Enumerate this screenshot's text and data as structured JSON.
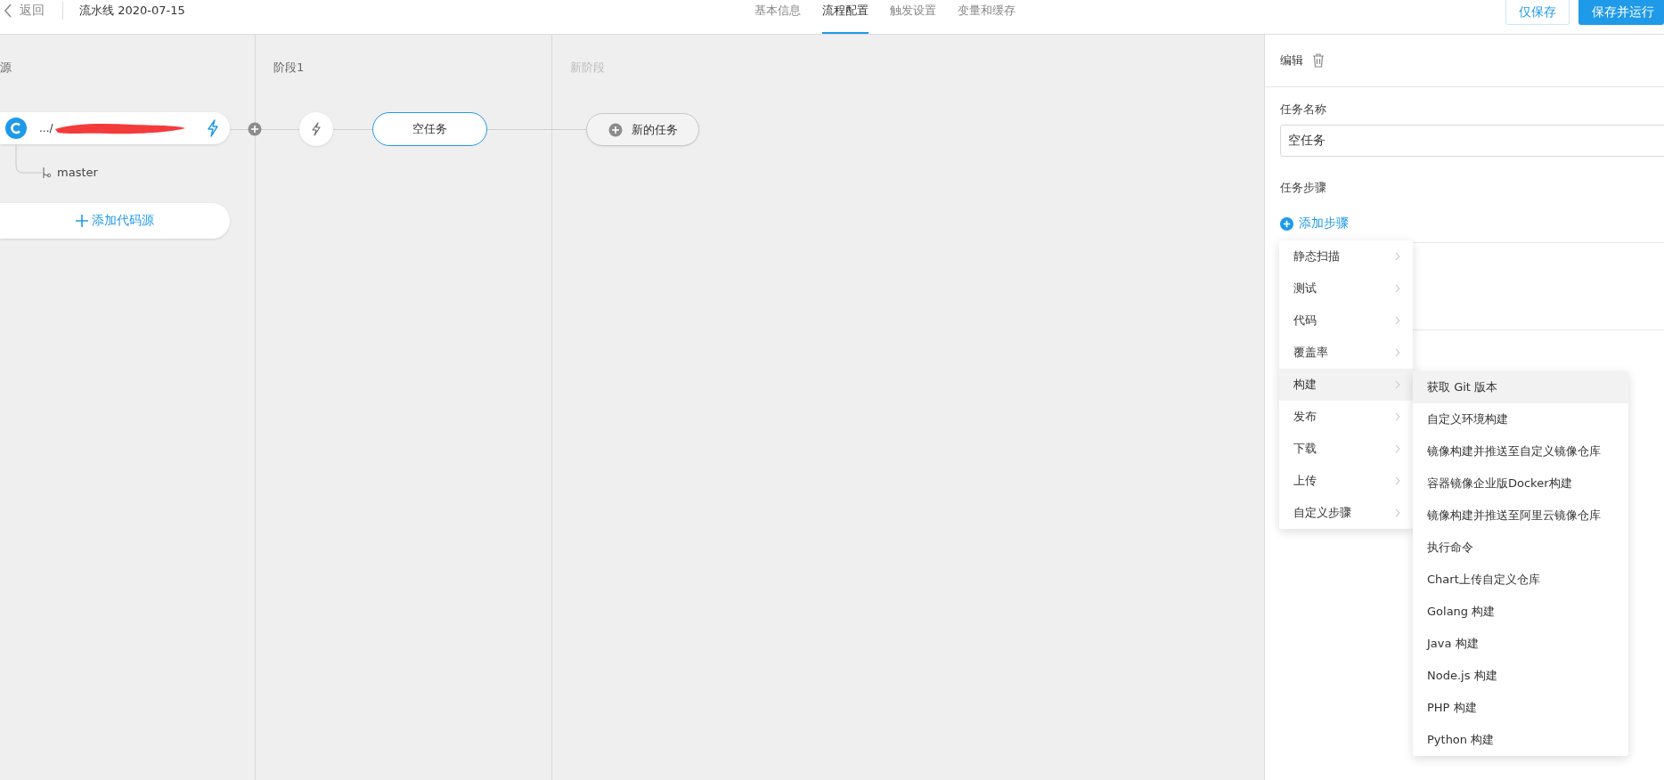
{
  "header": {
    "back": "返回",
    "title": "流水线 2020-07-15"
  },
  "tabs": [
    {
      "label": "基本信息",
      "selected": false
    },
    {
      "label": "流程配置",
      "selected": true
    },
    {
      "label": "触发设置",
      "selected": false
    },
    {
      "label": "变量和缓存",
      "selected": false
    }
  ],
  "buttons": [
    {
      "label": "仅保存",
      "kind": "secondary"
    },
    {
      "label": "保存并运行",
      "kind": "primary"
    }
  ],
  "source": {
    "title": "源",
    "repo": ".../",
    "branch": "master",
    "add_button": "添加代码源"
  },
  "stages": [
    {
      "title": "阶段1",
      "muted": false,
      "task": "空任务",
      "kind": "task"
    },
    {
      "title": "新阶段",
      "muted": true,
      "task": "新的任务",
      "kind": "new"
    }
  ],
  "editor": {
    "title": "编辑",
    "name_label": "任务名称",
    "name_value": "空任务",
    "steps_label": "任务步骤",
    "add_step": "添加步骤"
  },
  "step_menu": {
    "categories": [
      {
        "label": "静态扫描",
        "selected": false
      },
      {
        "label": "测试",
        "selected": false
      },
      {
        "label": "代码",
        "selected": false
      },
      {
        "label": "覆盖率",
        "selected": false
      },
      {
        "label": "构建",
        "selected": true
      },
      {
        "label": "发布",
        "selected": false
      },
      {
        "label": "下载",
        "selected": false
      },
      {
        "label": "上传",
        "selected": false
      },
      {
        "label": "自定义步骤",
        "selected": false
      }
    ],
    "submenu": [
      {
        "label": "获取 Git 版本",
        "selected": true
      },
      {
        "label": "自定义环境构建",
        "selected": false
      },
      {
        "label": "镜像构建并推送至自定义镜像仓库",
        "selected": false
      },
      {
        "label": "容器镜像企业版Docker构建",
        "selected": false
      },
      {
        "label": "镜像构建并推送至阿里云镜像仓库",
        "selected": false
      },
      {
        "label": "执行命令",
        "selected": false
      },
      {
        "label": "Chart上传自定义仓库",
        "selected": false
      },
      {
        "label": "Golang 构建",
        "selected": false
      },
      {
        "label": "Java 构建",
        "selected": false
      },
      {
        "label": "Node.js 构建",
        "selected": false
      },
      {
        "label": "PHP 构建",
        "selected": false
      },
      {
        "label": "Python 构建",
        "selected": false
      }
    ]
  }
}
